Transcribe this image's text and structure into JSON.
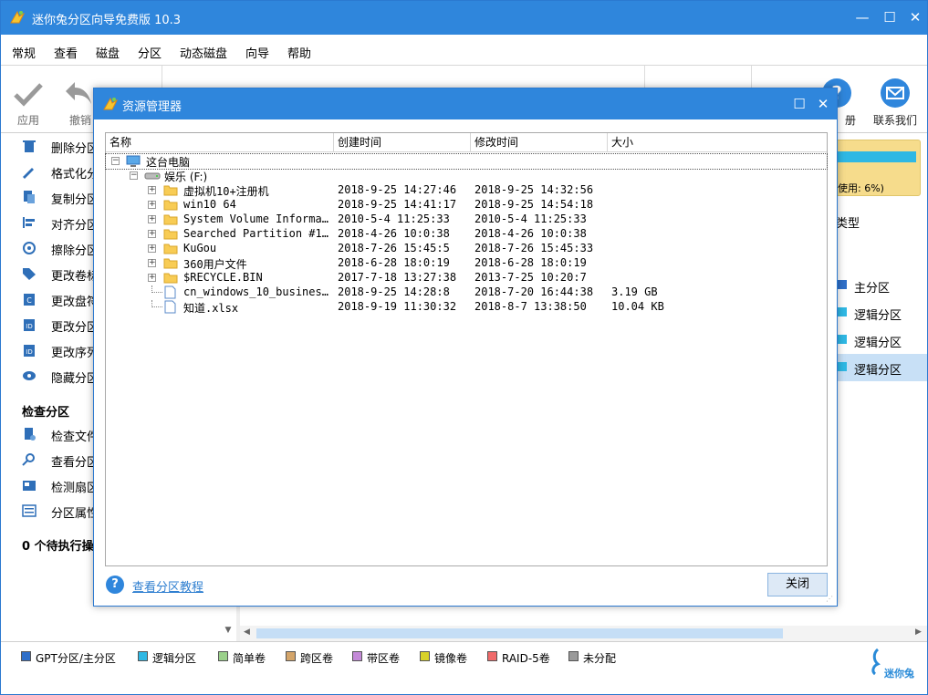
{
  "app": {
    "title": "迷你兔分区向导免费版 10.3",
    "brand_name": "迷你兔"
  },
  "menu": [
    "常规",
    "查看",
    "磁盘",
    "分区",
    "动态磁盘",
    "向导",
    "帮助"
  ],
  "toolbar": {
    "apply": "应用",
    "undo": "撤销",
    "register_partial": "册",
    "contact": "联系我们"
  },
  "sidebar": {
    "items_top": [
      "删除分区",
      "格式化分",
      "复制分区",
      "对齐分区",
      "擦除分区",
      "更改卷标",
      "更改盘符",
      "更改分区",
      "更改序列",
      "隐藏分区"
    ],
    "check_header": "检查分区",
    "items_check": [
      "检查文件",
      "查看分区",
      "检测扇区",
      "分区属性"
    ],
    "pending": "0 个待执行操"
  },
  "right_panel": {
    "disk_usage": "使用: 6%)",
    "disk_usage_fraction": 0.94,
    "type_header": "类型",
    "partitions": [
      {
        "label": "主分区",
        "color": "#2f6fc8"
      },
      {
        "label": "逻辑分区",
        "color": "#2fb8e4"
      },
      {
        "label": "逻辑分区",
        "color": "#2fb8e4"
      },
      {
        "label": "逻辑分区",
        "color": "#2fb8e4"
      }
    ]
  },
  "legend": [
    {
      "label": "GPT分区/主分区",
      "color": "#2f6fc8"
    },
    {
      "label": "逻辑分区",
      "color": "#2fb8e4"
    },
    {
      "label": "简单卷",
      "color": "#9ad08a"
    },
    {
      "label": "跨区卷",
      "color": "#d4a56a"
    },
    {
      "label": "带区卷",
      "color": "#c48ad8"
    },
    {
      "label": "镜像卷",
      "color": "#d8d22a"
    },
    {
      "label": "RAID-5卷",
      "color": "#f06a6a"
    },
    {
      "label": "未分配",
      "color": "#9a9a9a"
    }
  ],
  "dialog": {
    "title": "资源管理器",
    "columns": [
      "名称",
      "创建时间",
      "修改时间",
      "大小"
    ],
    "root_label": "这台电脑",
    "drive_label": "娱乐 (F:)",
    "entries": [
      {
        "name": "虚拟机10+注册机",
        "created": "2018-9-25 14:27:46",
        "modified": "2018-9-25 14:32:56",
        "size": "",
        "kind": "folder"
      },
      {
        "name": "win10 64",
        "created": "2018-9-25 14:41:17",
        "modified": "2018-9-25 14:54:18",
        "size": "",
        "kind": "folder"
      },
      {
        "name": "System Volume Informa…",
        "created": "2010-5-4 11:25:33",
        "modified": "2010-5-4 11:25:33",
        "size": "",
        "kind": "folder"
      },
      {
        "name": "Searched Partition #1…",
        "created": "2018-4-26 10:0:38",
        "modified": "2018-4-26 10:0:38",
        "size": "",
        "kind": "folder"
      },
      {
        "name": "KuGou",
        "created": "2018-7-26 15:45:5",
        "modified": "2018-7-26 15:45:33",
        "size": "",
        "kind": "folder"
      },
      {
        "name": "360用户文件",
        "created": "2018-6-28 18:0:19",
        "modified": "2018-6-28 18:0:19",
        "size": "",
        "kind": "folder"
      },
      {
        "name": "$RECYCLE.BIN",
        "created": "2017-7-18 13:27:38",
        "modified": "2013-7-25 10:20:7",
        "size": "",
        "kind": "folder"
      },
      {
        "name": "cn_windows_10_busines…",
        "created": "2018-9-25 14:28:8",
        "modified": "2018-7-20 16:44:38",
        "size": "3.19 GB",
        "kind": "file"
      },
      {
        "name": "知道.xlsx",
        "created": "2018-9-19 11:30:32",
        "modified": "2018-8-7 13:38:50",
        "size": "10.04 KB",
        "kind": "file"
      }
    ],
    "help_link": "查看分区教程",
    "close_button": "关闭"
  }
}
